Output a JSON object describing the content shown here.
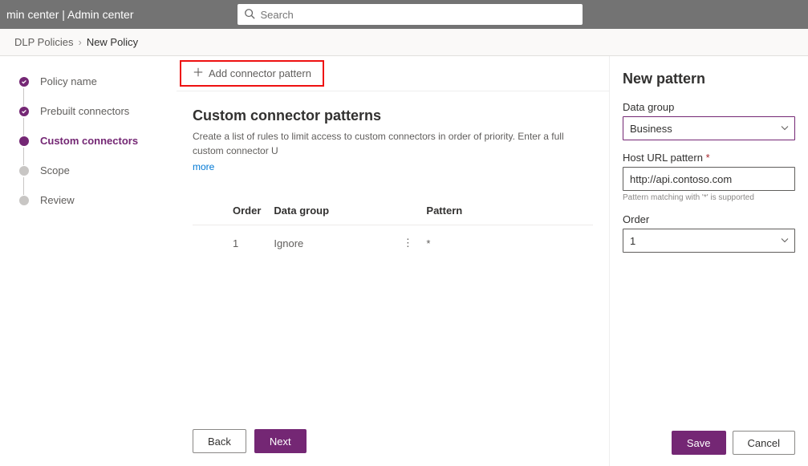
{
  "topbar": {
    "title": "min center  |  Admin center",
    "search_placeholder": "Search"
  },
  "breadcrumb": {
    "root": "DLP Policies",
    "current": "New Policy"
  },
  "steps": [
    {
      "label": "Policy name",
      "state": "done"
    },
    {
      "label": "Prebuilt connectors",
      "state": "done"
    },
    {
      "label": "Custom connectors",
      "state": "active"
    },
    {
      "label": "Scope",
      "state": "pending"
    },
    {
      "label": "Review",
      "state": "pending"
    }
  ],
  "commandbar": {
    "add_label": "Add connector pattern"
  },
  "section": {
    "title": "Custom connector patterns",
    "desc": "Create a list of rules to limit access to custom connectors in order of priority. Enter a full custom connector U",
    "more": "more"
  },
  "table": {
    "headers": {
      "order": "Order",
      "data_group": "Data group",
      "pattern": "Pattern"
    },
    "rows": [
      {
        "order": "1",
        "data_group": "Ignore",
        "pattern": "*"
      }
    ]
  },
  "footer": {
    "back": "Back",
    "next": "Next"
  },
  "panel": {
    "title": "New pattern",
    "data_group": {
      "label": "Data group",
      "value": "Business"
    },
    "host_url": {
      "label": "Host URL pattern",
      "value": "http://api.contoso.com",
      "hint": "Pattern matching with '*' is supported"
    },
    "order": {
      "label": "Order",
      "value": "1"
    },
    "save": "Save",
    "cancel": "Cancel"
  }
}
